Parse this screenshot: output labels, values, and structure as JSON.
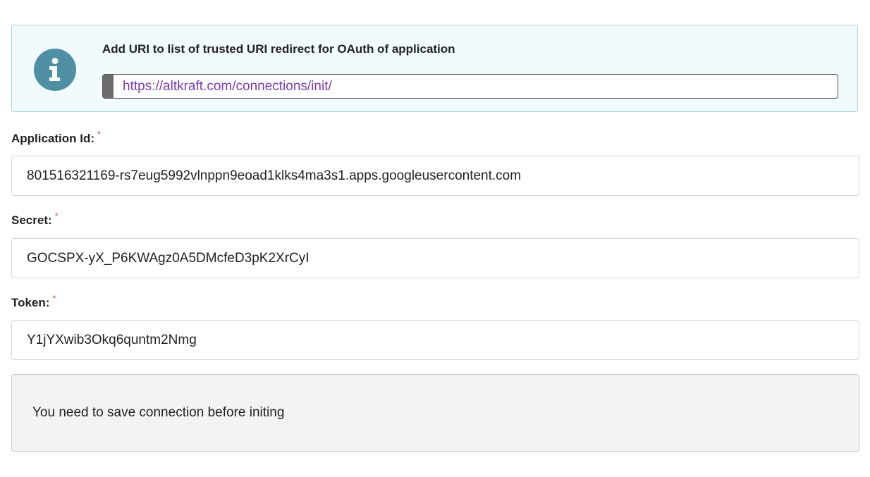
{
  "info_banner": {
    "icon": "info-icon",
    "title": "Add URI to list of trusted URI redirect for OAuth of application",
    "uri": "https://altkraft.com/connections/init/",
    "colors": {
      "background": "#f1fafc",
      "border": "#a9d5e0",
      "icon_bg": "#4e8fa4",
      "link": "#7b3bb0"
    }
  },
  "fields": {
    "application_id": {
      "label": "Application Id:",
      "required_mark": "*",
      "value": "801516321169-rs7eug5992vlnppn9eoad1klks4ma3s1.apps.googleusercontent.com"
    },
    "secret": {
      "label": "Secret:",
      "required_mark": "*",
      "value": "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"
    },
    "token": {
      "label": "Token:",
      "required_mark": "*",
      "value": "Y1jYXwib3Okq6quntm2Nmg"
    }
  },
  "notice": {
    "text": "You need to save connection before initing"
  }
}
